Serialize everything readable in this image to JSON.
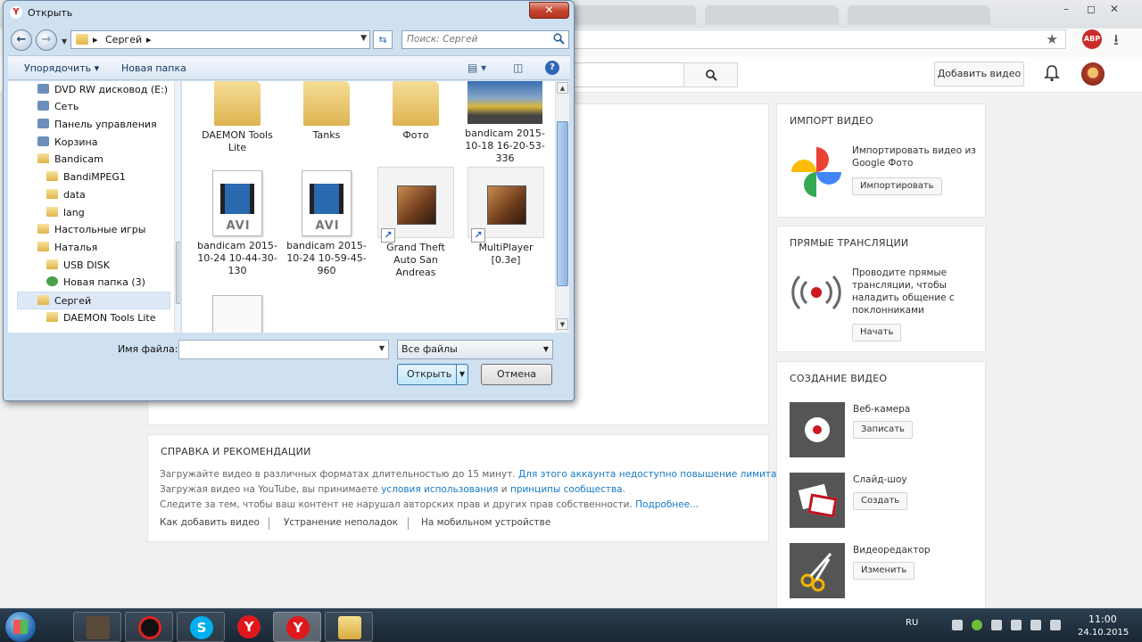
{
  "browser": {
    "ext_badge": "ABP",
    "bookmark_icon": "star-icon",
    "download_icon": "download-icon"
  },
  "yt": {
    "upload_btn": "Добавить видео",
    "import": {
      "title": "ИМПОРТ ВИДЕО",
      "text": "Импортировать видео из Google Фото",
      "button": "Импортировать"
    },
    "live": {
      "title": "ПРЯМЫЕ ТРАНСЛЯЦИИ",
      "text": "Проводите прямые трансляции, чтобы наладить общение с поклонниками",
      "button": "Начать"
    },
    "create": {
      "title": "СОЗДАНИЕ ВИДЕО",
      "items": [
        {
          "label": "Веб-камера",
          "button": "Записать"
        },
        {
          "label": "Слайд-шоу",
          "button": "Создать"
        },
        {
          "label": "Видеоредактор",
          "button": "Изменить"
        }
      ]
    },
    "help": {
      "title": "СПРАВКА И РЕКОМЕНДАЦИИ",
      "line1": "Загружайте видео в различных форматах длительностью до 15 минут.",
      "line1_link": "Для этого аккаунта недоступно повышение лимита.",
      "line2a": "Загружая видео на YouTube, вы принимаете",
      "line2_link1": "условия использования",
      "line2b": "и",
      "line2_link2": "принципы сообщества",
      "line2c": ".",
      "line3": "Следите за тем, чтобы ваш контент не нарушал авторских прав и других прав собственности.",
      "line3_link": "Подробнее...",
      "footer": [
        "Как добавить видео",
        "Устранение неполадок",
        "На мобильном устройстве"
      ]
    }
  },
  "dialog": {
    "title": "Открыть",
    "close": "✕",
    "breadcrumb": [
      "Сергей"
    ],
    "search_placeholder": "Поиск: Сергей",
    "toolbar": {
      "organize": "Упорядочить",
      "new_folder": "Новая папка"
    },
    "tree": [
      {
        "label": "DVD RW дисковод (E:)",
        "indent": 1,
        "kind": "sys"
      },
      {
        "label": "Сеть",
        "indent": 0,
        "kind": "sys"
      },
      {
        "label": "Панель управления",
        "indent": 0,
        "kind": "sys"
      },
      {
        "label": "Корзина",
        "indent": 0,
        "kind": "sys"
      },
      {
        "label": "Bandicam",
        "indent": 0,
        "kind": "folder"
      },
      {
        "label": "BandiMPEG1",
        "indent": 1,
        "kind": "folder"
      },
      {
        "label": "data",
        "indent": 1,
        "kind": "folder"
      },
      {
        "label": "lang",
        "indent": 1,
        "kind": "folder"
      },
      {
        "label": "Настольные игры",
        "indent": 0,
        "kind": "folder"
      },
      {
        "label": "Наталья",
        "indent": 0,
        "kind": "folder"
      },
      {
        "label": "USB DISK",
        "indent": 1,
        "kind": "folder"
      },
      {
        "label": "Новая папка (3)",
        "indent": 1,
        "kind": "sys"
      },
      {
        "label": "Сергей",
        "indent": 0,
        "kind": "folder",
        "selected": true
      },
      {
        "label": "DAEMON Tools Lite",
        "indent": 1,
        "kind": "folder"
      }
    ],
    "files": [
      {
        "name": "DAEMON Tools Lite",
        "type": "folder"
      },
      {
        "name": "Tanks",
        "type": "folder"
      },
      {
        "name": "Фото",
        "type": "folder"
      },
      {
        "name": "bandicam 2015-10-18 16-20-53-336",
        "type": "image"
      },
      {
        "name": "bandicam 2015-10-24 10-44-30-130",
        "type": "avi"
      },
      {
        "name": "bandicam 2015-10-24 10-59-45-960",
        "type": "avi"
      },
      {
        "name": "Grand Theft Auto San Andreas",
        "type": "shortcut"
      },
      {
        "name": "MultiPlayer [0.3e]",
        "type": "shortcut"
      },
      {
        "name": "",
        "type": "doc"
      }
    ],
    "filename_label": "Имя файла:",
    "filename_value": "",
    "filter": "Все файлы",
    "open_btn": "Открыть",
    "cancel_btn": "Отмена",
    "avi_label": "AVI"
  },
  "taskbar": {
    "lang": "RU",
    "time": "11:00",
    "date": "24.10.2015",
    "apps": [
      "media-app",
      "obs-app",
      "skype-app",
      "yandex-browser",
      "yandex-browser-active",
      "file-manager"
    ]
  }
}
